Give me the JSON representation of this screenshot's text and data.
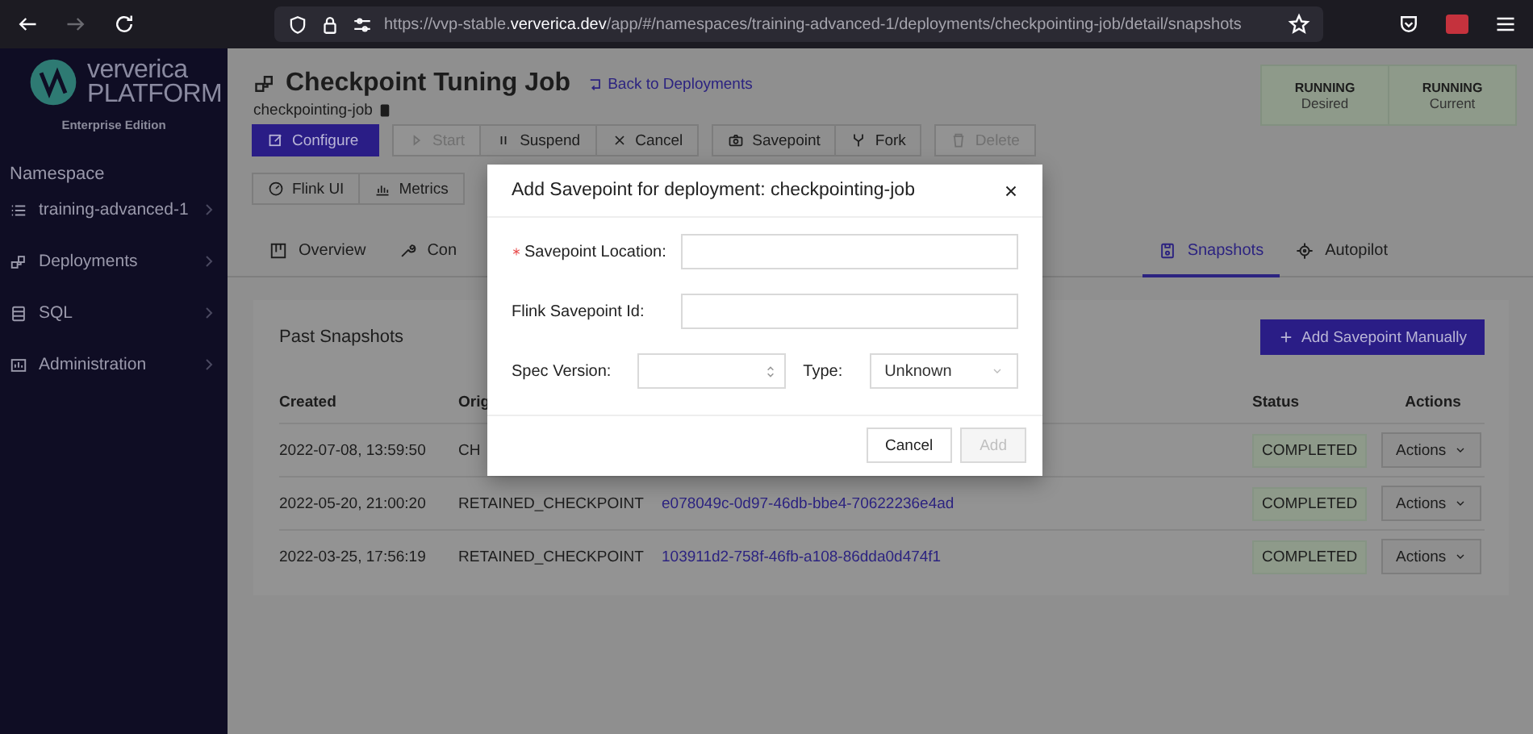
{
  "browser": {
    "url_prefix": "https://vvp-stable.",
    "url_domain": "ververica.dev",
    "url_path": "/app/#/namespaces/training-advanced-1/deployments/checkpointing-job/detail/snapshots"
  },
  "sidebar": {
    "logo_top": "ververica",
    "logo_bottom": "PLATFORM",
    "edition": "Enterprise Edition",
    "section": "Namespace",
    "items": [
      {
        "label": "training-advanced-1"
      },
      {
        "label": "Deployments"
      },
      {
        "label": "SQL"
      },
      {
        "label": "Administration"
      }
    ]
  },
  "deployment": {
    "title": "Checkpoint Tuning Job",
    "back_link": "Back to Deployments",
    "name": "checkpointing-job",
    "actions": [
      {
        "label": "Configure",
        "kind": "primary",
        "disabled": false
      },
      {
        "label": "Start",
        "kind": "default",
        "disabled": true
      },
      {
        "label": "Suspend",
        "kind": "default",
        "disabled": false
      },
      {
        "label": "Cancel",
        "kind": "default",
        "disabled": false
      },
      {
        "label": "Savepoint",
        "kind": "default",
        "disabled": false
      },
      {
        "label": "Fork",
        "kind": "default",
        "disabled": false
      },
      {
        "label": "Delete",
        "kind": "default",
        "disabled": true
      }
    ],
    "links": [
      {
        "label": "Flink UI"
      },
      {
        "label": "Metrics"
      }
    ],
    "status": [
      {
        "value": "RUNNING",
        "label": "Desired"
      },
      {
        "value": "RUNNING",
        "label": "Current"
      }
    ]
  },
  "tabs": [
    {
      "label": "Overview",
      "selected": false
    },
    {
      "label": "Con",
      "selected": false
    },
    {
      "label": "Snapshots",
      "selected": true
    },
    {
      "label": "Autopilot",
      "selected": false
    }
  ],
  "snapshots": {
    "title": "Past Snapshots",
    "add_button": "Add Savepoint Manually",
    "columns": [
      "Created",
      "Orig",
      "Status",
      "Actions"
    ],
    "rows": [
      {
        "created": "2022-07-08, 13:59:50",
        "origin": "CH",
        "status": "COMPLETED",
        "action": "Actions"
      },
      {
        "created": "2022-05-20, 21:00:20",
        "origin": "RETAINED_CHECKPOINT",
        "id": "e078049c-0d97-46db-bbe4-70622236e4ad",
        "status": "COMPLETED",
        "action": "Actions"
      },
      {
        "created": "2022-03-25, 17:56:19",
        "origin": "RETAINED_CHECKPOINT",
        "id": "103911d2-758f-46fb-a108-86dda0d474f1",
        "status": "COMPLETED",
        "action": "Actions"
      }
    ]
  },
  "modal": {
    "title": "Add Savepoint for deployment: checkpointing-job",
    "fields": [
      {
        "label": "Savepoint Location:",
        "kind": "text",
        "required": true
      },
      {
        "label": "Flink Savepoint Id:",
        "kind": "text",
        "required": false
      },
      {
        "label": "Spec Version:",
        "kind": "number",
        "required": false
      },
      {
        "label": "Type:",
        "kind": "select",
        "required": false,
        "value": "Unknown"
      }
    ],
    "buttons": [
      {
        "label": "Cancel",
        "disabled": false
      },
      {
        "label": "Add",
        "disabled": true
      }
    ]
  }
}
